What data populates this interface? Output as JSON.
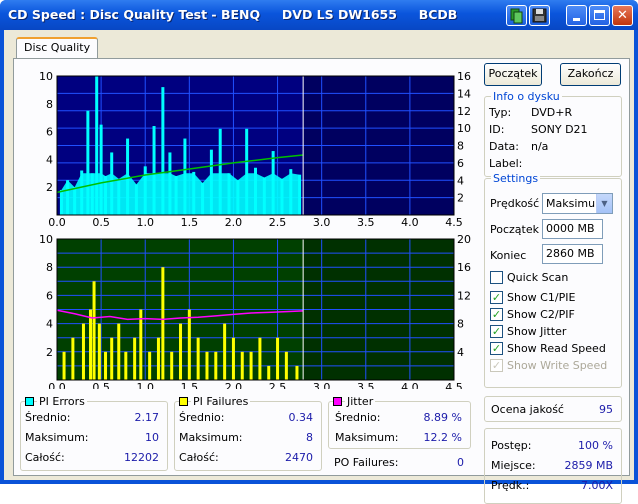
{
  "window": {
    "title": "CD Speed : Disc Quality Test - BENQ     DVD LS DW1655     BCDB"
  },
  "tabs": {
    "active": "Disc Quality"
  },
  "buttons": {
    "start": "Początek",
    "end": "Zakończ"
  },
  "disc_info": {
    "title": "Info o dysku",
    "rows": [
      {
        "label": "Typ:",
        "value": "DVD+R"
      },
      {
        "label": "ID:",
        "value": "SONY D21"
      },
      {
        "label": "Data:",
        "value": "n/a"
      },
      {
        "label": "Label:",
        "value": ""
      }
    ]
  },
  "settings": {
    "title": "Settings",
    "speed_label": "Prędkość",
    "speed_value": "Maksimum",
    "start_label": "Początek",
    "start_value": "0000 MB",
    "end_label": "Koniec",
    "end_value": "2860 MB",
    "checks": [
      {
        "label": "Quick Scan",
        "checked": false,
        "enabled": true
      },
      {
        "label": "Show C1/PIE",
        "checked": true,
        "enabled": true
      },
      {
        "label": "Show C2/PIF",
        "checked": true,
        "enabled": true
      },
      {
        "label": "Show Jitter",
        "checked": true,
        "enabled": true
      },
      {
        "label": "Show Read Speed",
        "checked": true,
        "enabled": true
      },
      {
        "label": "Show Write Speed",
        "checked": true,
        "enabled": false
      }
    ]
  },
  "quality": {
    "label": "Ocena jakość",
    "value": "95"
  },
  "progress": {
    "rows": [
      {
        "label": "Postęp:",
        "value": "100 %"
      },
      {
        "label": "Miejsce:",
        "value": "2859 MB"
      },
      {
        "label": "Prędk.:",
        "value": "7.00X"
      }
    ]
  },
  "stats": {
    "pi_errors": {
      "title": "PI Errors",
      "color": "#00ffff",
      "rows": [
        {
          "label": "Średnio:",
          "value": "2.17"
        },
        {
          "label": "Maksimum:",
          "value": "10"
        },
        {
          "label": "Całość:",
          "value": "12202"
        }
      ]
    },
    "pi_failures": {
      "title": "PI Failures",
      "color": "#ffff00",
      "rows": [
        {
          "label": "Średnio:",
          "value": "0.34"
        },
        {
          "label": "Maksimum:",
          "value": "8"
        },
        {
          "label": "Całość:",
          "value": "2470"
        }
      ]
    },
    "jitter": {
      "title": "Jitter",
      "color": "#ff00ff",
      "rows": [
        {
          "label": "Średnio:",
          "value": "8.89 %"
        },
        {
          "label": "Maksimum:",
          "value": "12.2 %"
        }
      ]
    },
    "po_failures": {
      "label": "PO Failures:",
      "value": "0"
    }
  },
  "chart_data": [
    {
      "type": "bar",
      "title": "",
      "x_ticks": [
        "0.0",
        "0.5",
        "1.0",
        "1.5",
        "2.0",
        "2.5",
        "3.0",
        "3.5",
        "4.0",
        "4.5"
      ],
      "y_left_ticks": [
        "2",
        "4",
        "6",
        "8",
        "10"
      ],
      "y_right_ticks": [
        "2",
        "4",
        "6",
        "8",
        "10",
        "12",
        "14",
        "16"
      ],
      "xlim": [
        0,
        4.5
      ],
      "ylim_left": [
        0,
        10
      ],
      "ylim_right": [
        0,
        16
      ],
      "scan_end": 2.79,
      "series": [
        {
          "name": "PI Errors",
          "color": "#00ffff",
          "axis": "left",
          "x": [
            0.05,
            0.12,
            0.2,
            0.28,
            0.35,
            0.4,
            0.45,
            0.5,
            0.55,
            0.62,
            0.7,
            0.8,
            0.9,
            1.0,
            1.1,
            1.2,
            1.28,
            1.35,
            1.45,
            1.55,
            1.65,
            1.75,
            1.85,
            1.95,
            2.05,
            2.15,
            2.25,
            2.35,
            2.45,
            2.55,
            2.65,
            2.75
          ],
          "values": [
            1.8,
            2.5,
            2.0,
            3.2,
            7.5,
            3.0,
            10,
            6.5,
            2.8,
            4.5,
            2.6,
            5.5,
            2.2,
            3.5,
            6.4,
            9.2,
            4.5,
            2.8,
            5.5,
            3.1,
            2.3,
            4.7,
            6.2,
            3.0,
            2.5,
            6.2,
            3.4,
            2.7,
            4.6,
            2.6,
            3.3,
            2.9
          ]
        },
        {
          "name": "Read Speed",
          "color": "#00c000",
          "axis": "right",
          "x": [
            0.0,
            0.5,
            1.0,
            1.5,
            2.0,
            2.5,
            2.79
          ],
          "values": [
            2.6,
            3.7,
            4.6,
            5.3,
            6.0,
            6.6,
            6.9
          ]
        }
      ]
    },
    {
      "type": "bar",
      "title": "",
      "x_ticks": [
        "0.0",
        "0.5",
        "1.0",
        "1.5",
        "2.0",
        "2.5",
        "3.0",
        "3.5",
        "4.0",
        "4.5"
      ],
      "y_left_ticks": [
        "2",
        "4",
        "6",
        "8",
        "10"
      ],
      "y_right_ticks": [
        "4",
        "8",
        "12",
        "16",
        "20"
      ],
      "xlim": [
        0,
        4.5
      ],
      "ylim_left": [
        0,
        10
      ],
      "ylim_right": [
        0,
        20
      ],
      "scan_end": 2.79,
      "series": [
        {
          "name": "PI Failures",
          "color": "#ffff00",
          "axis": "left",
          "x": [
            0.08,
            0.18,
            0.3,
            0.38,
            0.42,
            0.48,
            0.55,
            0.62,
            0.7,
            0.78,
            0.88,
            0.95,
            1.05,
            1.15,
            1.2,
            1.3,
            1.4,
            1.5,
            1.6,
            1.7,
            1.8,
            1.9,
            2.0,
            2.1,
            2.2,
            2.3,
            2.4,
            2.5,
            2.6,
            2.72
          ],
          "values": [
            2,
            3,
            4,
            5,
            7,
            4,
            2,
            3,
            4,
            2,
            3,
            5,
            2,
            3,
            8,
            2,
            4,
            5,
            3,
            2,
            2,
            4,
            3,
            2,
            2,
            3,
            1,
            3,
            2,
            1
          ]
        },
        {
          "name": "Jitter",
          "color": "#ff00ff",
          "axis": "right",
          "x": [
            0.0,
            0.2,
            0.4,
            0.6,
            0.8,
            1.0,
            1.2,
            1.4,
            1.6,
            1.8,
            2.0,
            2.2,
            2.4,
            2.6,
            2.79
          ],
          "values": [
            9.9,
            9.4,
            8.8,
            9.0,
            8.6,
            8.7,
            8.6,
            8.8,
            8.9,
            9.1,
            9.3,
            9.5,
            9.6,
            9.7,
            9.8
          ]
        }
      ]
    }
  ]
}
